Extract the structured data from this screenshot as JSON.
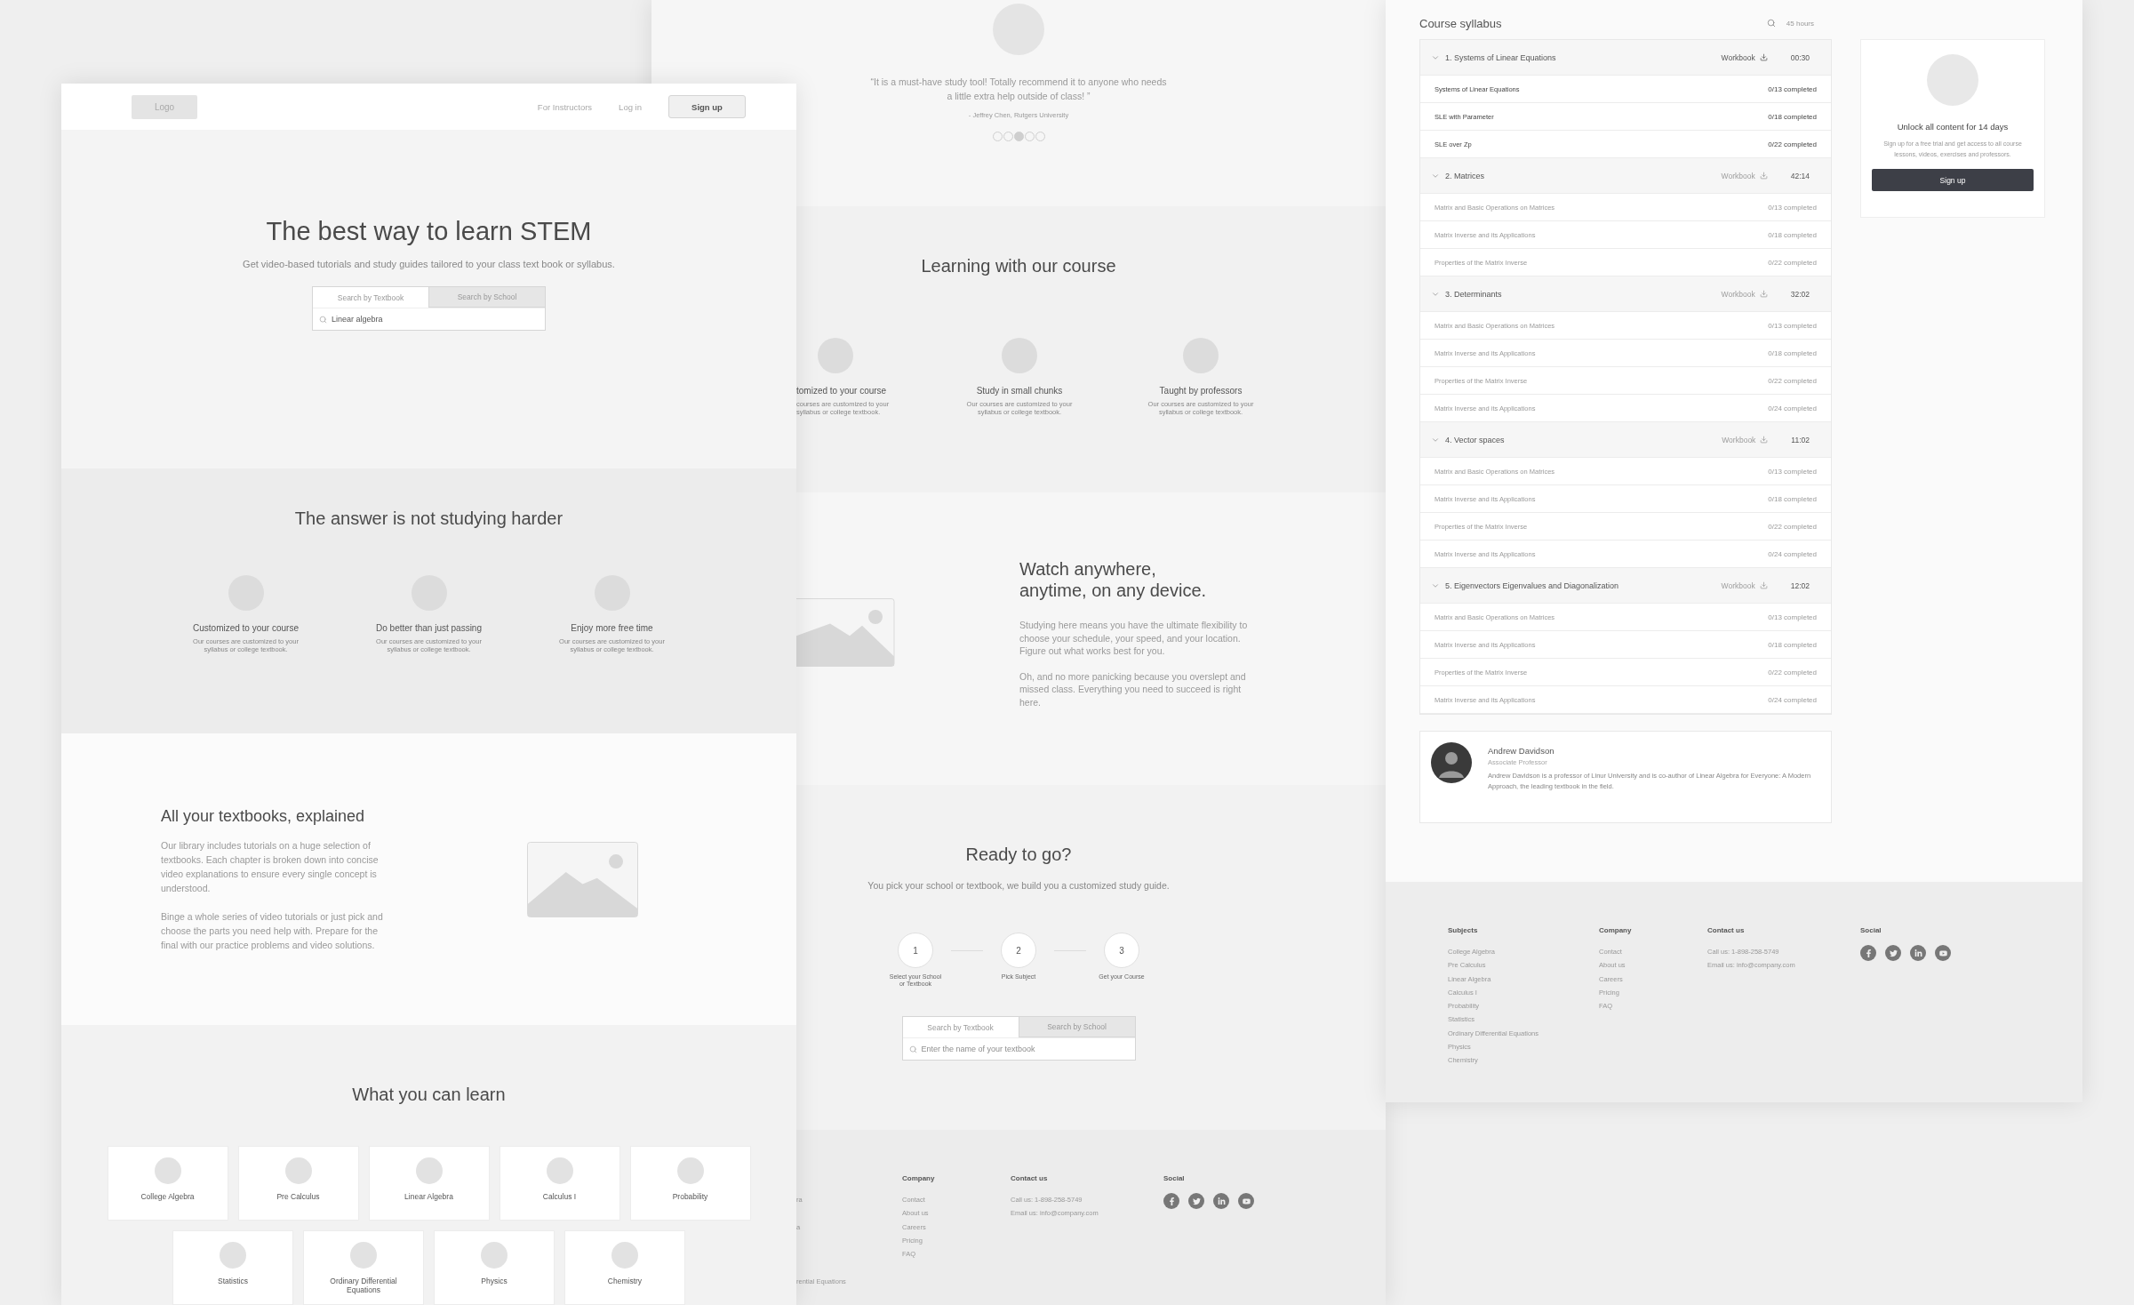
{
  "landing_page": {
    "header": {
      "logo": "Logo",
      "links": [
        "For Instructors",
        "Log in"
      ],
      "signup": "Sign up"
    },
    "hero": {
      "title": "The best way to learn STEM",
      "subtitle": "Get video-based tutorials and study guides tailored to your class text book or syllabus.",
      "search": {
        "tabs": [
          {
            "label": "Search by Textbook",
            "selected": true
          },
          {
            "label": "Search by School",
            "selected": false
          }
        ],
        "value": "Linear algebra"
      }
    },
    "answer": {
      "title": "The answer is not studying harder",
      "features": [
        {
          "title": "Customized to your course",
          "text": "Our courses are customized to your syllabus or college textbook."
        },
        {
          "title": "Do better than just passing",
          "text": "Our courses are customized to your syllabus or college textbook."
        },
        {
          "title": "Enjoy more free time",
          "text": "Our courses are customized to your syllabus or college textbook."
        }
      ]
    },
    "textbooks": {
      "title": "All your textbooks, explained",
      "paragraphs": [
        "Our library includes tutorials on a huge selection of textbooks. Each chapter is broken down into concise video explanations to ensure every single concept is understood.",
        "Binge a whole series of video tutorials or just pick and choose the parts you need help with. Prepare for the final with our practice problems and video solutions."
      ]
    },
    "learn": {
      "title": "What you can learn",
      "subjects": [
        "College Algebra",
        "Pre Calculus",
        "Linear Algebra",
        "Calculus I",
        "Probability",
        "Statistics",
        "Ordinary Differential Equations",
        "Physics",
        "Chemistry"
      ]
    }
  },
  "middle_page": {
    "testimonial": {
      "quote": "“It is a must-have study tool! Totally recommend it to anyone who needs a little extra help outside of class! ”",
      "author": "- Jeffrey Chen, Rutgers University",
      "dots": [
        {
          "selected": false
        },
        {
          "selected": false
        },
        {
          "selected": true
        },
        {
          "selected": false
        },
        {
          "selected": false
        }
      ]
    },
    "learning": {
      "title": "Learning with our course",
      "features": [
        {
          "title": "tomized to your course",
          "text": "courses are customized to your syllabus or college textbook."
        },
        {
          "title": "Study in small chunks",
          "text": "Our courses are customized to your syllabus or college textbook."
        },
        {
          "title": "Taught by professors",
          "text": "Our courses are customized to your syllabus or college textbook."
        }
      ]
    },
    "watch": {
      "title_lines": [
        "Watch anywhere,",
        "anytime, on any device."
      ],
      "paragraphs": [
        "Studying here means you have the ultimate flexibility to choose your schedule, your speed, and your location. Figure out what works best for you.",
        "Oh, and no more panicking because you overslept and missed class. Everything you need to succeed is right here."
      ]
    },
    "ready": {
      "title": "Ready to go?",
      "subtitle": "You pick your school or textbook, we build you a customized study guide.",
      "steps": [
        {
          "number": "1",
          "label": "Select your School or Textbook"
        },
        {
          "number": "2",
          "label": "Pick Subject"
        },
        {
          "number": "3",
          "label": "Get your Course"
        }
      ],
      "search": {
        "tabs": [
          {
            "label": "Search by Textbook",
            "selected": true
          },
          {
            "label": "Search by School",
            "selected": false
          }
        ],
        "placeholder": "Enter the name of your textbook"
      }
    },
    "footer": {
      "subject_fragments": [
        "ra",
        "a",
        "rential Equations"
      ],
      "columns": [
        {
          "heading": "Company",
          "items": [
            "Contact",
            "About us",
            "Careers",
            "Pricing",
            "FAQ"
          ]
        },
        {
          "heading": "Contact us",
          "items": [
            "Call us: 1-898-258-5749",
            "Email us: info@company.com"
          ]
        }
      ],
      "social_heading": "Social"
    }
  },
  "course_page": {
    "syllabus": {
      "title": "Course syllabus",
      "total": "45 hours",
      "chapters": [
        {
          "title": "1. Systems of Linear Equations",
          "workbook": "Workbook",
          "duration": "00:30",
          "expanded": true,
          "available": true,
          "lessons": [
            {
              "title": "Systems of Linear Equations",
              "progress": "0/13 completed"
            },
            {
              "title": "SLE with Parameter",
              "progress": "0/18 completed"
            },
            {
              "title": "SLE over Zp",
              "progress": "0/22 completed"
            }
          ]
        },
        {
          "title": "2. Matrices",
          "workbook": "Workbook",
          "duration": "42:14",
          "expanded": true,
          "available": false,
          "lessons": [
            {
              "title": "Matrix and Basic Operations on Matrices",
              "progress": "0/13 completed"
            },
            {
              "title": "Matrix Inverse and its Applications",
              "progress": "0/18 completed"
            },
            {
              "title": "Properties of the Matrix Inverse",
              "progress": "0/22 completed"
            }
          ]
        },
        {
          "title": "3. Determinants",
          "workbook": "Workbook",
          "duration": "32:02",
          "expanded": true,
          "available": false,
          "lessons": [
            {
              "title": "Matrix and Basic Operations on Matrices",
              "progress": "0/13 completed"
            },
            {
              "title": "Matrix Inverse and its Applications",
              "progress": "0/18 completed"
            },
            {
              "title": "Properties of the Matrix Inverse",
              "progress": "0/22 completed"
            },
            {
              "title": "Matrix Inverse and its Applications",
              "progress": "0/24 completed"
            }
          ]
        },
        {
          "title": "4. Vector spaces",
          "workbook": "Workbook",
          "duration": "11:02",
          "expanded": true,
          "available": false,
          "lessons": [
            {
              "title": "Matrix and Basic Operations on Matrices",
              "progress": "0/13 completed"
            },
            {
              "title": "Matrix Inverse and its Applications",
              "progress": "0/18 completed"
            },
            {
              "title": "Properties of the Matrix Inverse",
              "progress": "0/22 completed"
            },
            {
              "title": "Matrix Inverse and its Applications",
              "progress": "0/24 completed"
            }
          ]
        },
        {
          "title": "5. Eigenvectors Eigenvalues and Diagonalization",
          "workbook": "Workbook",
          "duration": "12:02",
          "expanded": true,
          "available": false,
          "lessons": [
            {
              "title": "Matrix and Basic Operations on Matrices",
              "progress": "0/13 completed"
            },
            {
              "title": "Matrix Inverse and its Applications",
              "progress": "0/18 completed"
            },
            {
              "title": "Properties of the Matrix Inverse",
              "progress": "0/22 completed"
            },
            {
              "title": "Matrix Inverse and its Applications",
              "progress": "0/24 completed"
            }
          ]
        }
      ]
    },
    "unlock": {
      "title": "Unlock all content for 14 days",
      "text": "Sign up for a free trial and get access to all course lessons, videos, exercises and professors.",
      "button": "Sign up"
    },
    "instructor": {
      "name": "Andrew Davidson",
      "role": "Associate Professor",
      "bio": "Andrew Davidson is a professor of Linur University and is co-author of Linear Algebra for Everyone: A Modern Approach, the leading textbook in the field."
    },
    "footer": {
      "columns": [
        {
          "heading": "Subjects",
          "items": [
            "College Algebra",
            "Pre Calculus",
            "Linear Algebra",
            "Calculus I",
            "Probability",
            "Statistics",
            "Ordinary Differential Equations",
            "Physics",
            "Chemistry"
          ]
        },
        {
          "heading": "Company",
          "items": [
            "Contact",
            "About us",
            "Careers",
            "Pricing",
            "FAQ"
          ]
        },
        {
          "heading": "Contact us",
          "items": [
            "Call us: 1-898-258-5749",
            "Email us: info@company.com"
          ]
        }
      ],
      "social_heading": "Social"
    }
  }
}
